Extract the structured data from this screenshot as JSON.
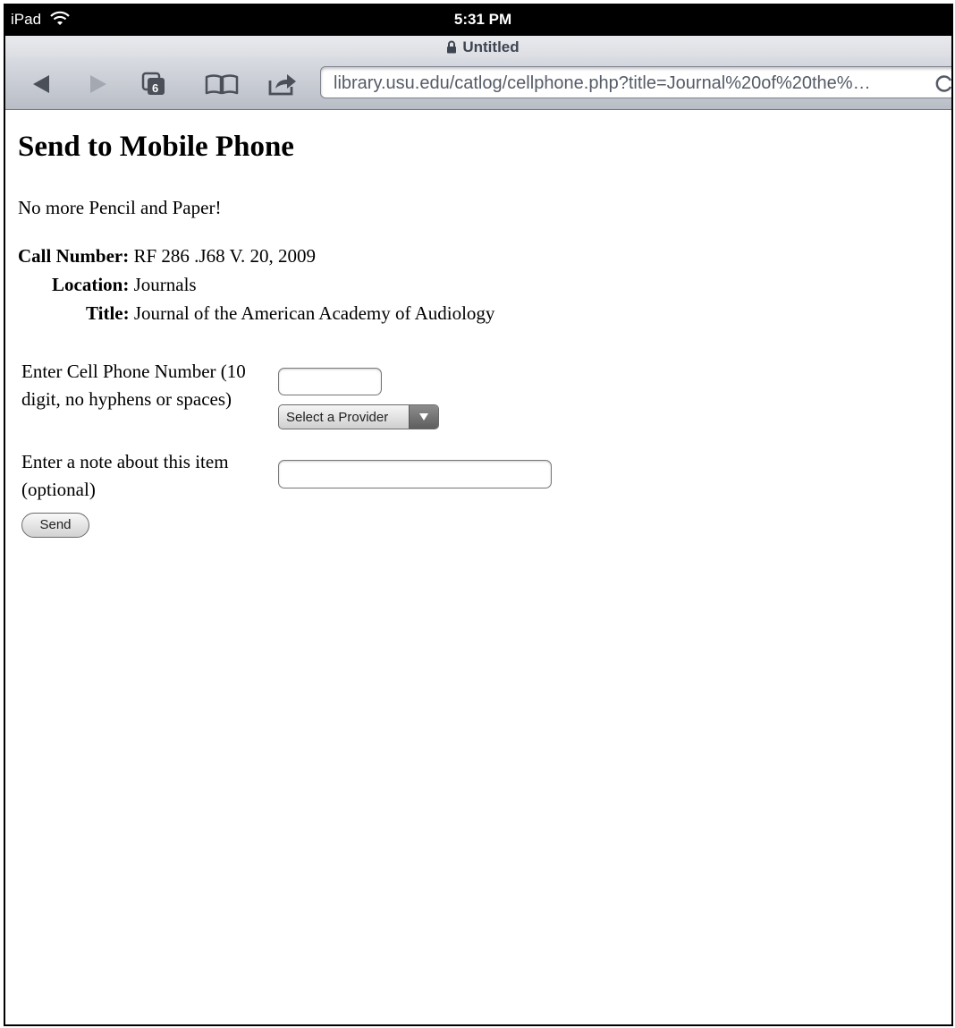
{
  "status_bar": {
    "device": "iPad",
    "time": "5:31 PM"
  },
  "browser": {
    "page_title": "Untitled",
    "url": "library.usu.edu/catlog/cellphone.php?title=Journal%20of%20the%…",
    "tab_count": "6",
    "icons": {
      "back": "back-arrow-icon",
      "forward": "forward-arrow-icon",
      "tabs": "tabs-icon",
      "bookmarks": "book-icon",
      "share": "share-icon",
      "reload": "reload-icon",
      "lock": "lock-icon",
      "wifi": "wifi-icon"
    }
  },
  "page": {
    "heading": "Send to Mobile Phone",
    "tagline": "No more Pencil and Paper!",
    "details": {
      "call_number_label": "Call Number:",
      "call_number_value": "RF 286 .J68 V. 20, 2009",
      "location_label": "Location:",
      "location_value": "Journals",
      "title_label": "Title:",
      "title_value": "Journal of the American Academy of Audiology"
    },
    "form": {
      "phone_label": "Enter Cell Phone Number (10 digit, no hyphens or spaces)",
      "phone_value": "",
      "provider_selected": "Select a Provider",
      "note_label": "Enter a note about this item (optional)",
      "note_value": "",
      "send_label": "Send"
    }
  }
}
